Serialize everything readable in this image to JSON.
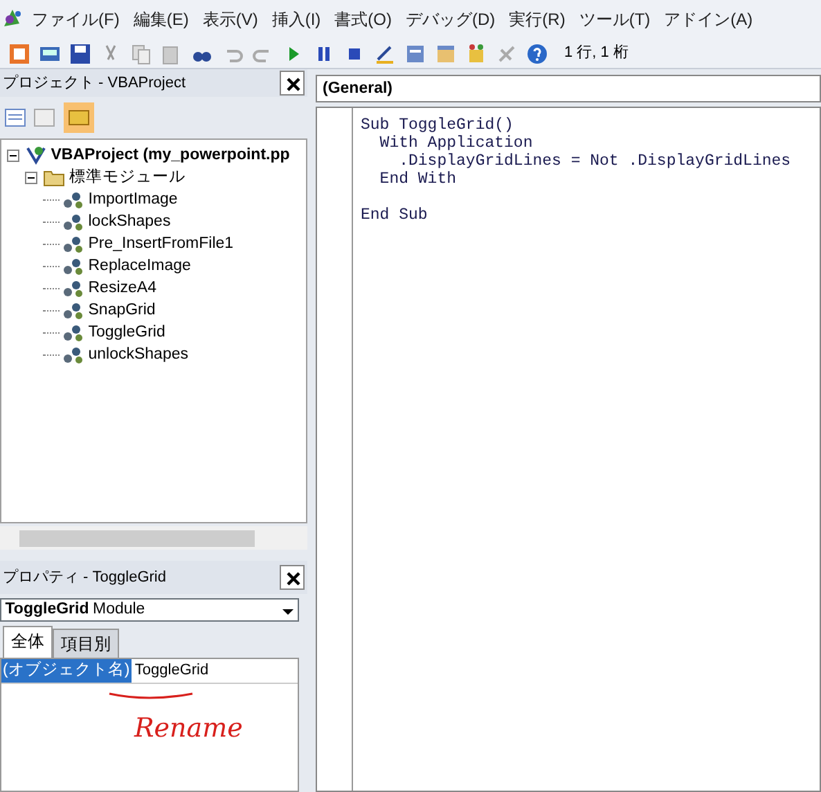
{
  "menu": [
    "ファイル(F)",
    "編集(E)",
    "表示(V)",
    "挿入(I)",
    "書式(O)",
    "デバッグ(D)",
    "実行(R)",
    "ツール(T)",
    "アドイン(A)"
  ],
  "toolbar": {
    "position": "1 行, 1 桁"
  },
  "project_pane": {
    "title": "プロジェクト - VBAProject",
    "tree": [
      {
        "label": "VBAProject (my_powerpoint.pp",
        "kind": "project",
        "expanded": true,
        "children": [
          {
            "label": "標準モジュール",
            "kind": "folder",
            "expanded": true,
            "children": [
              {
                "label": "ImportImage",
                "kind": "module"
              },
              {
                "label": "lockShapes",
                "kind": "module"
              },
              {
                "label": "Pre_InsertFromFile1",
                "kind": "module"
              },
              {
                "label": "ReplaceImage",
                "kind": "module"
              },
              {
                "label": "ResizeA4",
                "kind": "module"
              },
              {
                "label": "SnapGrid",
                "kind": "module"
              },
              {
                "label": "ToggleGrid",
                "kind": "module"
              },
              {
                "label": "unlockShapes",
                "kind": "module"
              }
            ]
          }
        ]
      }
    ]
  },
  "properties_pane": {
    "title": "プロパティ - ToggleGrid",
    "object": {
      "name": "ToggleGrid",
      "type": "Module"
    },
    "tabs": [
      {
        "label": "全体",
        "selected": true
      },
      {
        "label": "項目別",
        "selected": false
      }
    ],
    "rows": [
      {
        "name": "(オブジェクト名)",
        "value": "ToggleGrid",
        "selected": true
      }
    ]
  },
  "annotation": {
    "text": "Rename",
    "color": "#d8201c"
  },
  "code": {
    "object": "(General)",
    "lines": [
      {
        "kind": "code",
        "text": "Sub ToggleGrid()"
      },
      {
        "kind": "code",
        "text": "  With Application"
      },
      {
        "kind": "code",
        "text": "    .DisplayGridLines = Not .DisplayGridLines"
      },
      {
        "kind": "code",
        "text": "  End With"
      },
      {
        "kind": "blank"
      },
      {
        "kind": "code",
        "text": "End Sub"
      }
    ]
  }
}
